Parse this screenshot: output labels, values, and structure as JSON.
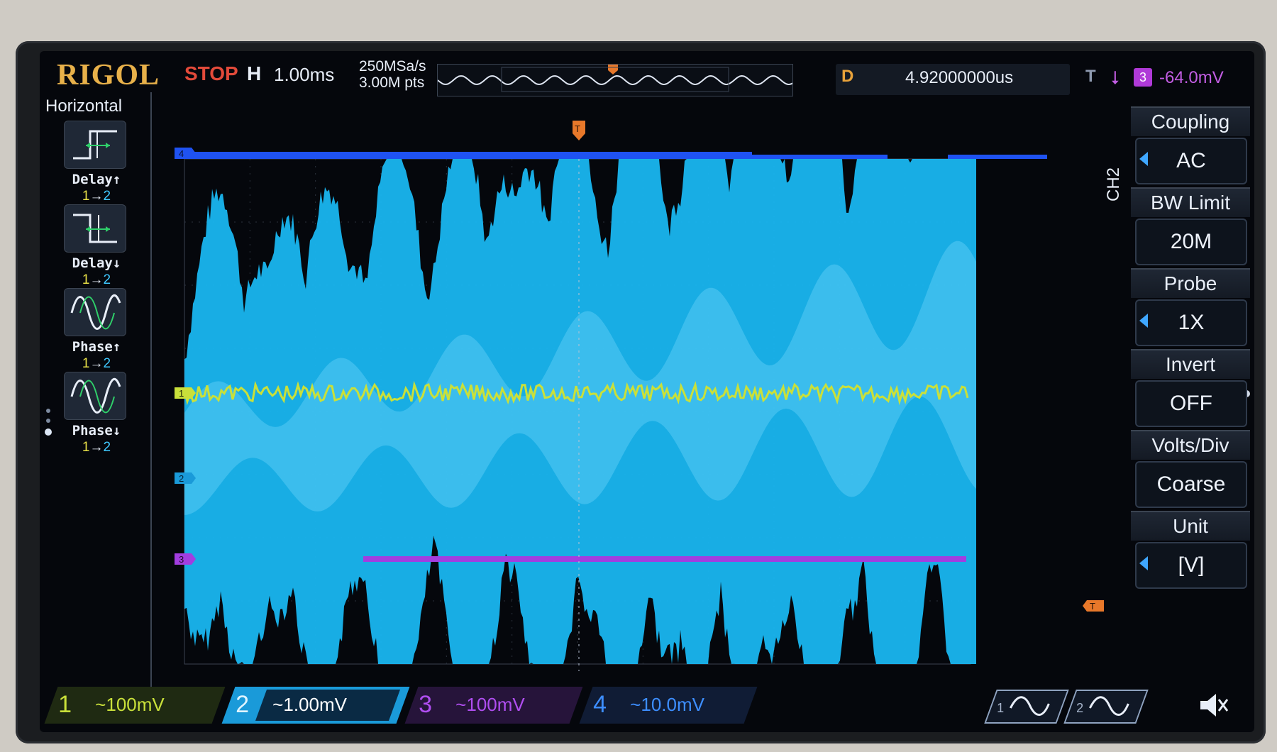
{
  "brand": "RIGOL",
  "top": {
    "run_status": "STOP",
    "h_label": "H",
    "timebase": "1.00ms",
    "sample_rate": "250MSa/s",
    "memory_depth": "3.00M pts",
    "d_label": "D",
    "delay": "4.92000000us",
    "trigger_label": "T",
    "trigger_source": "3",
    "trigger_level": "-64.0mV"
  },
  "left_menu": {
    "title": "Horizontal",
    "items": [
      {
        "label": "Delay↑",
        "from": "1",
        "to": "2",
        "icon": "delay-rising-icon"
      },
      {
        "label": "Delay↓",
        "from": "1",
        "to": "2",
        "icon": "delay-falling-icon"
      },
      {
        "label": "Phase↑",
        "from": "1",
        "to": "2",
        "icon": "phase-rising-icon"
      },
      {
        "label": "Phase↓",
        "from": "1",
        "to": "2",
        "icon": "phase-falling-icon"
      }
    ],
    "arrow": "→"
  },
  "right_menu": {
    "channel": "CH2",
    "items": [
      {
        "title": "Coupling",
        "value": "AC",
        "has_arrow": true
      },
      {
        "title": "BW Limit",
        "value": "20M",
        "has_arrow": false
      },
      {
        "title": "Probe",
        "value": "1X",
        "has_arrow": true
      },
      {
        "title": "Invert",
        "value": "OFF",
        "has_arrow": false
      },
      {
        "title": "Volts/Div",
        "value": "Coarse",
        "has_arrow": false
      },
      {
        "title": "Unit",
        "value": "[V]",
        "has_arrow": true
      }
    ]
  },
  "markers": {
    "ch1": "1",
    "ch2": "2",
    "ch3": "3",
    "ch4": "4",
    "trig": "T"
  },
  "bottom": {
    "channels": [
      {
        "num": "1",
        "scale": "~100mV",
        "color": "#c9e03a"
      },
      {
        "num": "2",
        "scale": "~1.00mV",
        "color": "#1a9ad9"
      },
      {
        "num": "3",
        "scale": "~100mV",
        "color": "#b04ef0"
      },
      {
        "num": "4",
        "scale": "~10.0mV",
        "color": "#3d8eff"
      }
    ],
    "math": [
      "1",
      "2"
    ]
  },
  "colors": {
    "ch1": "#c9e03a",
    "ch2": "#1ab4ee",
    "ch3": "#a23de0",
    "ch4": "#1f52f2",
    "trigger": "#e8782a",
    "accent": "#e34a3a"
  }
}
